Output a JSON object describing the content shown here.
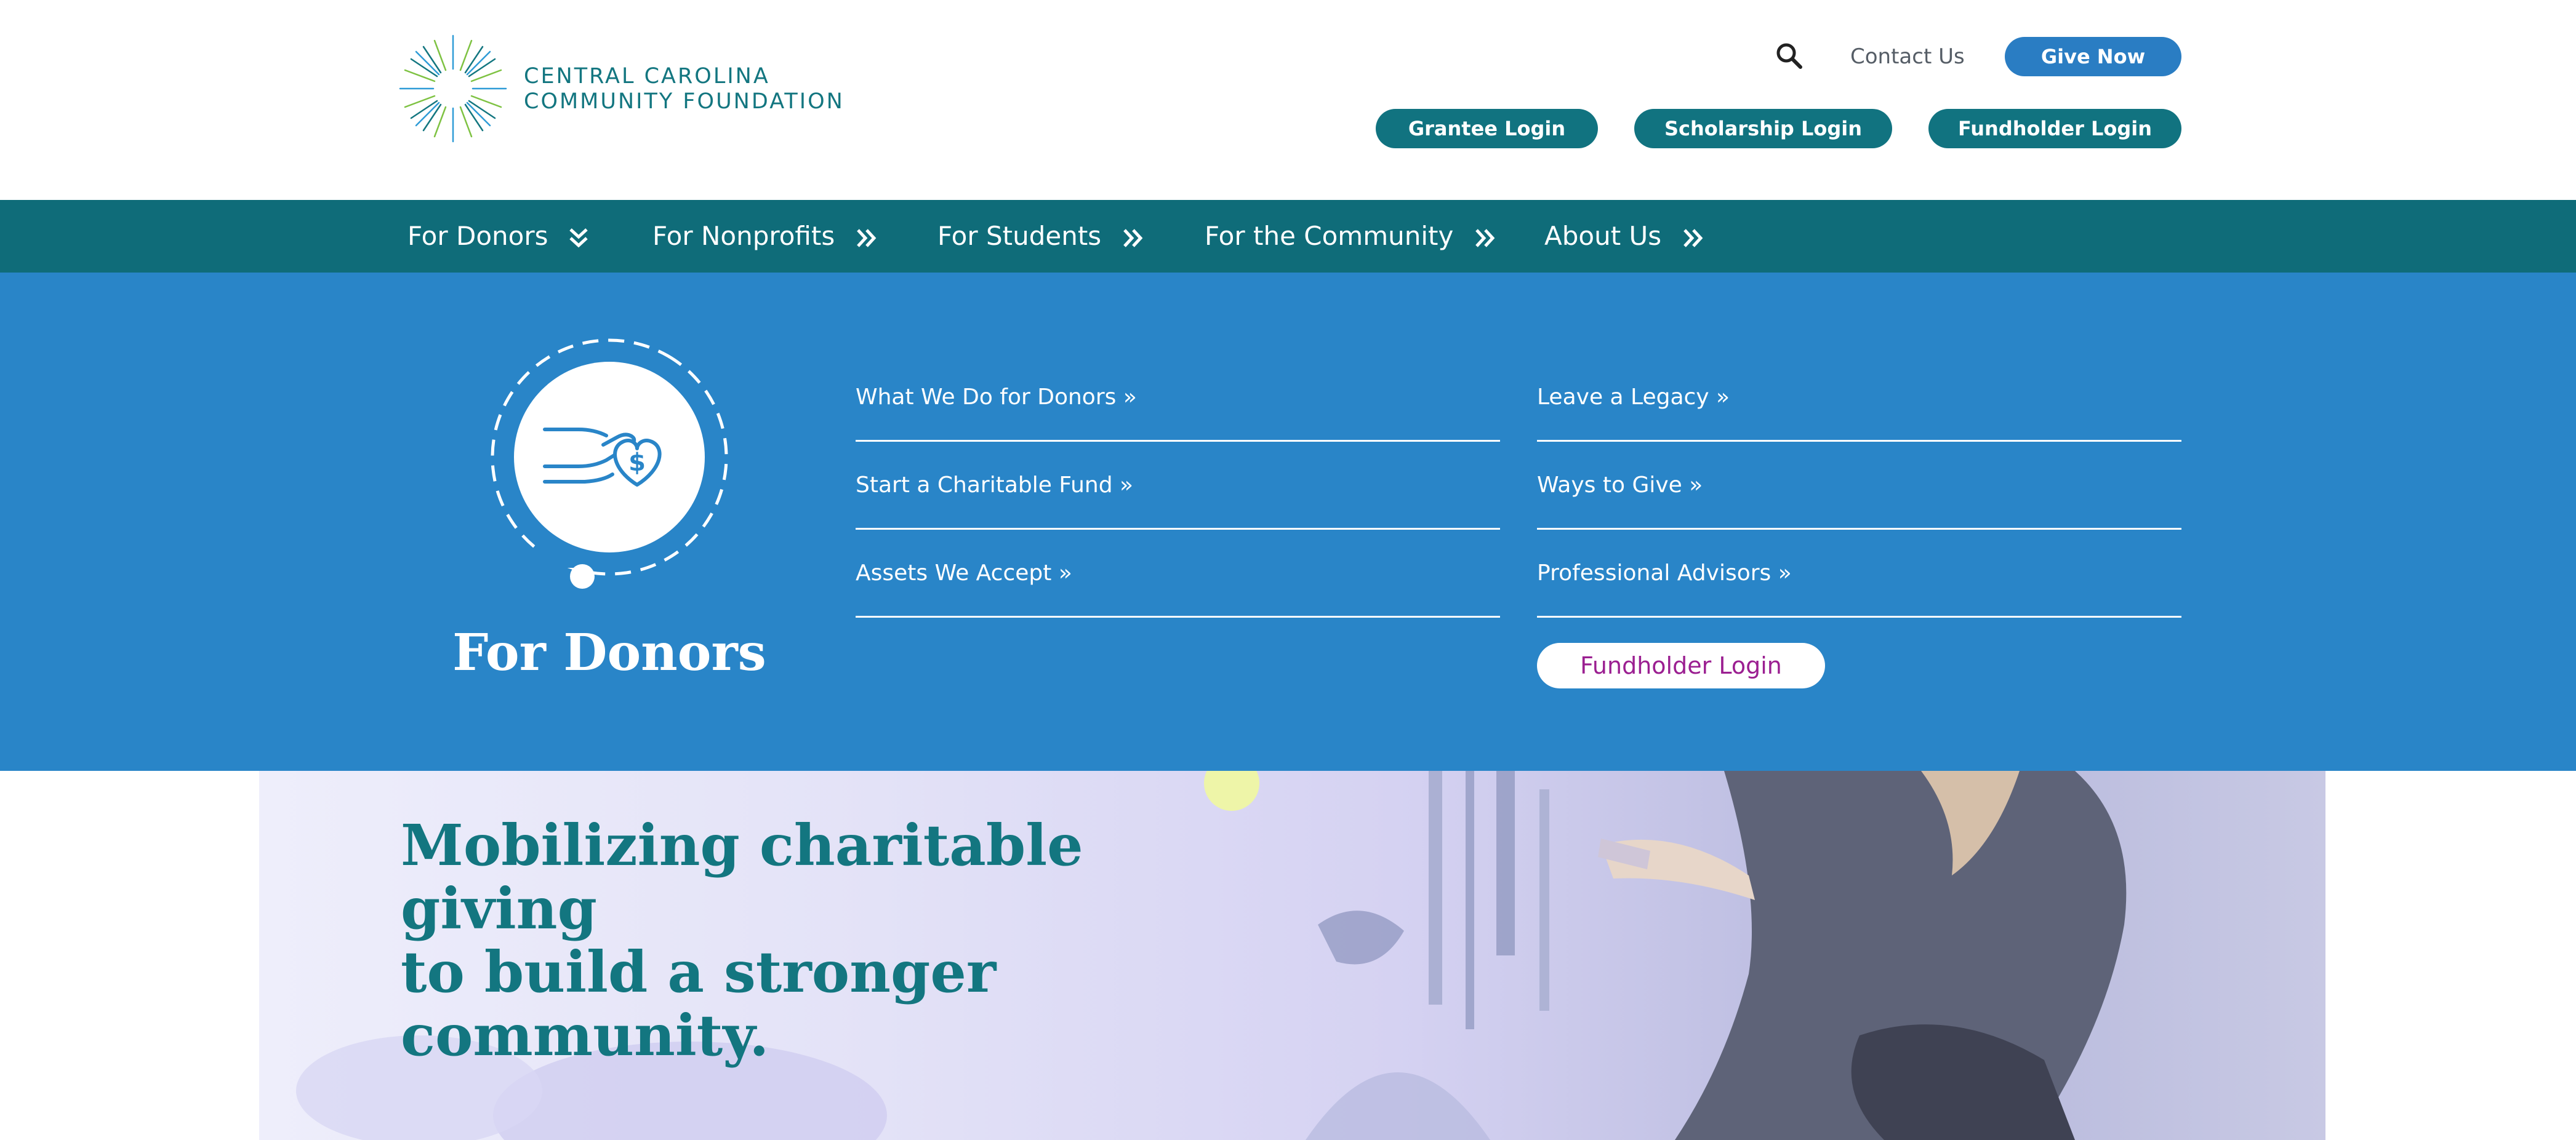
{
  "header": {
    "logo": {
      "line1": "CENTRAL CAROLINA",
      "line2": "COMMUNITY FOUNDATION"
    },
    "search_icon": "search-icon",
    "contact_label": "Contact Us",
    "give_label": "Give Now",
    "login_buttons": [
      "Grantee Login",
      "Scholarship Login",
      "Fundholder Login"
    ]
  },
  "nav": {
    "items": [
      {
        "label": "For Donors",
        "icon": "chevron-double-down-icon"
      },
      {
        "label": "For Nonprofits",
        "icon": "chevron-double-right-icon"
      },
      {
        "label": "For Students",
        "icon": "chevron-double-right-icon"
      },
      {
        "label": "For the Community",
        "icon": "chevron-double-right-icon"
      },
      {
        "label": "About Us",
        "icon": "chevron-double-right-icon"
      }
    ]
  },
  "mega_menu": {
    "title": "For Donors",
    "icon": "donor-giving-hand-icon",
    "left_links": [
      "What We Do for Donors »",
      "Start a Charitable Fund »",
      "Assets We Accept »"
    ],
    "right_links": [
      "Leave a Legacy »",
      "Ways to Give »",
      "Professional Advisors »"
    ],
    "button_label": "Fundholder Login"
  },
  "hero": {
    "heading_line1": "Mobilizing charitable giving",
    "heading_line2": "to build a stronger",
    "heading_line3": "community."
  },
  "colors": {
    "teal": "#0f6c79",
    "teal_text": "#137680",
    "blue": "#2a7dc3",
    "mega_blue": "#2985c8",
    "magenta": "#9b1f91"
  }
}
